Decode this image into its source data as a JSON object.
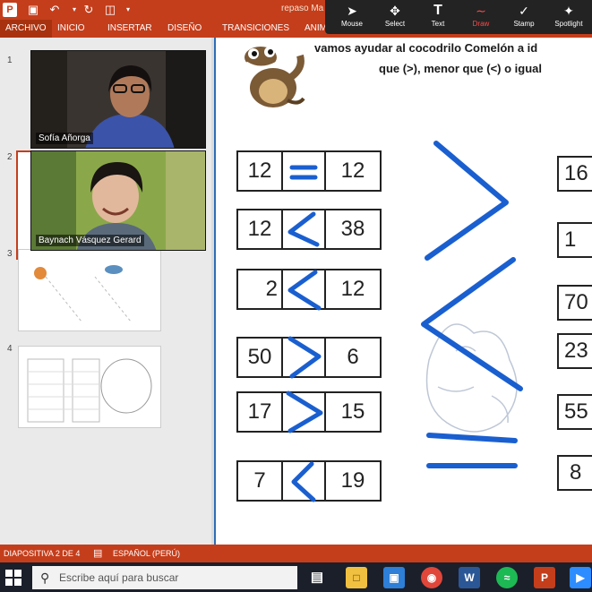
{
  "titlebar": {
    "app_icon": "P",
    "icons": [
      "save-icon",
      "undo-icon",
      "redo-icon",
      "presenter-icon"
    ],
    "doc_title": "repaso Ma"
  },
  "ribbon": {
    "tabs": [
      "ARCHIVO",
      "INICIO",
      "INSERTAR",
      "DISEÑO",
      "TRANSICIONES",
      "ANIM"
    ]
  },
  "annotate": {
    "tools": [
      {
        "label": "Mouse",
        "icon": "mouse-pointer-icon"
      },
      {
        "label": "Select",
        "icon": "select-move-icon"
      },
      {
        "label": "Text",
        "icon": "text-icon"
      },
      {
        "label": "Draw",
        "icon": "draw-icon"
      },
      {
        "label": "Stamp",
        "icon": "stamp-icon"
      },
      {
        "label": "Spotlight",
        "icon": "spotlight-icon"
      }
    ]
  },
  "thumbs": {
    "numbers": [
      "1",
      "2",
      "3",
      "4"
    ]
  },
  "videos": [
    {
      "name": "Sofía Añorga"
    },
    {
      "name": "Baynach Vásquez Gerard"
    }
  ],
  "slide": {
    "title_line1": "vamos ayudar al cocodrilo Comelón a id",
    "title_line2": "que (>),  menor que (<) o igual",
    "comparisons": [
      {
        "left": "12",
        "right": "12",
        "symbol": "="
      },
      {
        "left": "12",
        "right": "38",
        "symbol": "<"
      },
      {
        "left": "2",
        "right": "12",
        "symbol": "<"
      },
      {
        "left": "50",
        "right": "6",
        "symbol": ">"
      },
      {
        "left": "17",
        "right": "15",
        "symbol": ">"
      },
      {
        "left": "7",
        "right": "19",
        "symbol": "<"
      }
    ],
    "right_column": [
      "16",
      "1",
      "70",
      "23",
      "55",
      "8"
    ]
  },
  "status": {
    "slide_info": "DIAPOSITIVA 2 DE 4",
    "language": "ESPAÑOL (PERÚ)"
  },
  "taskbar": {
    "search_placeholder": "Escribe aquí para buscar",
    "apps": [
      "task-view",
      "file-explorer",
      "store",
      "chrome",
      "word",
      "spotify",
      "powerpoint",
      "zoom"
    ]
  },
  "colors": {
    "accent": "#c43e1c",
    "ink": "#1a5fd0"
  }
}
